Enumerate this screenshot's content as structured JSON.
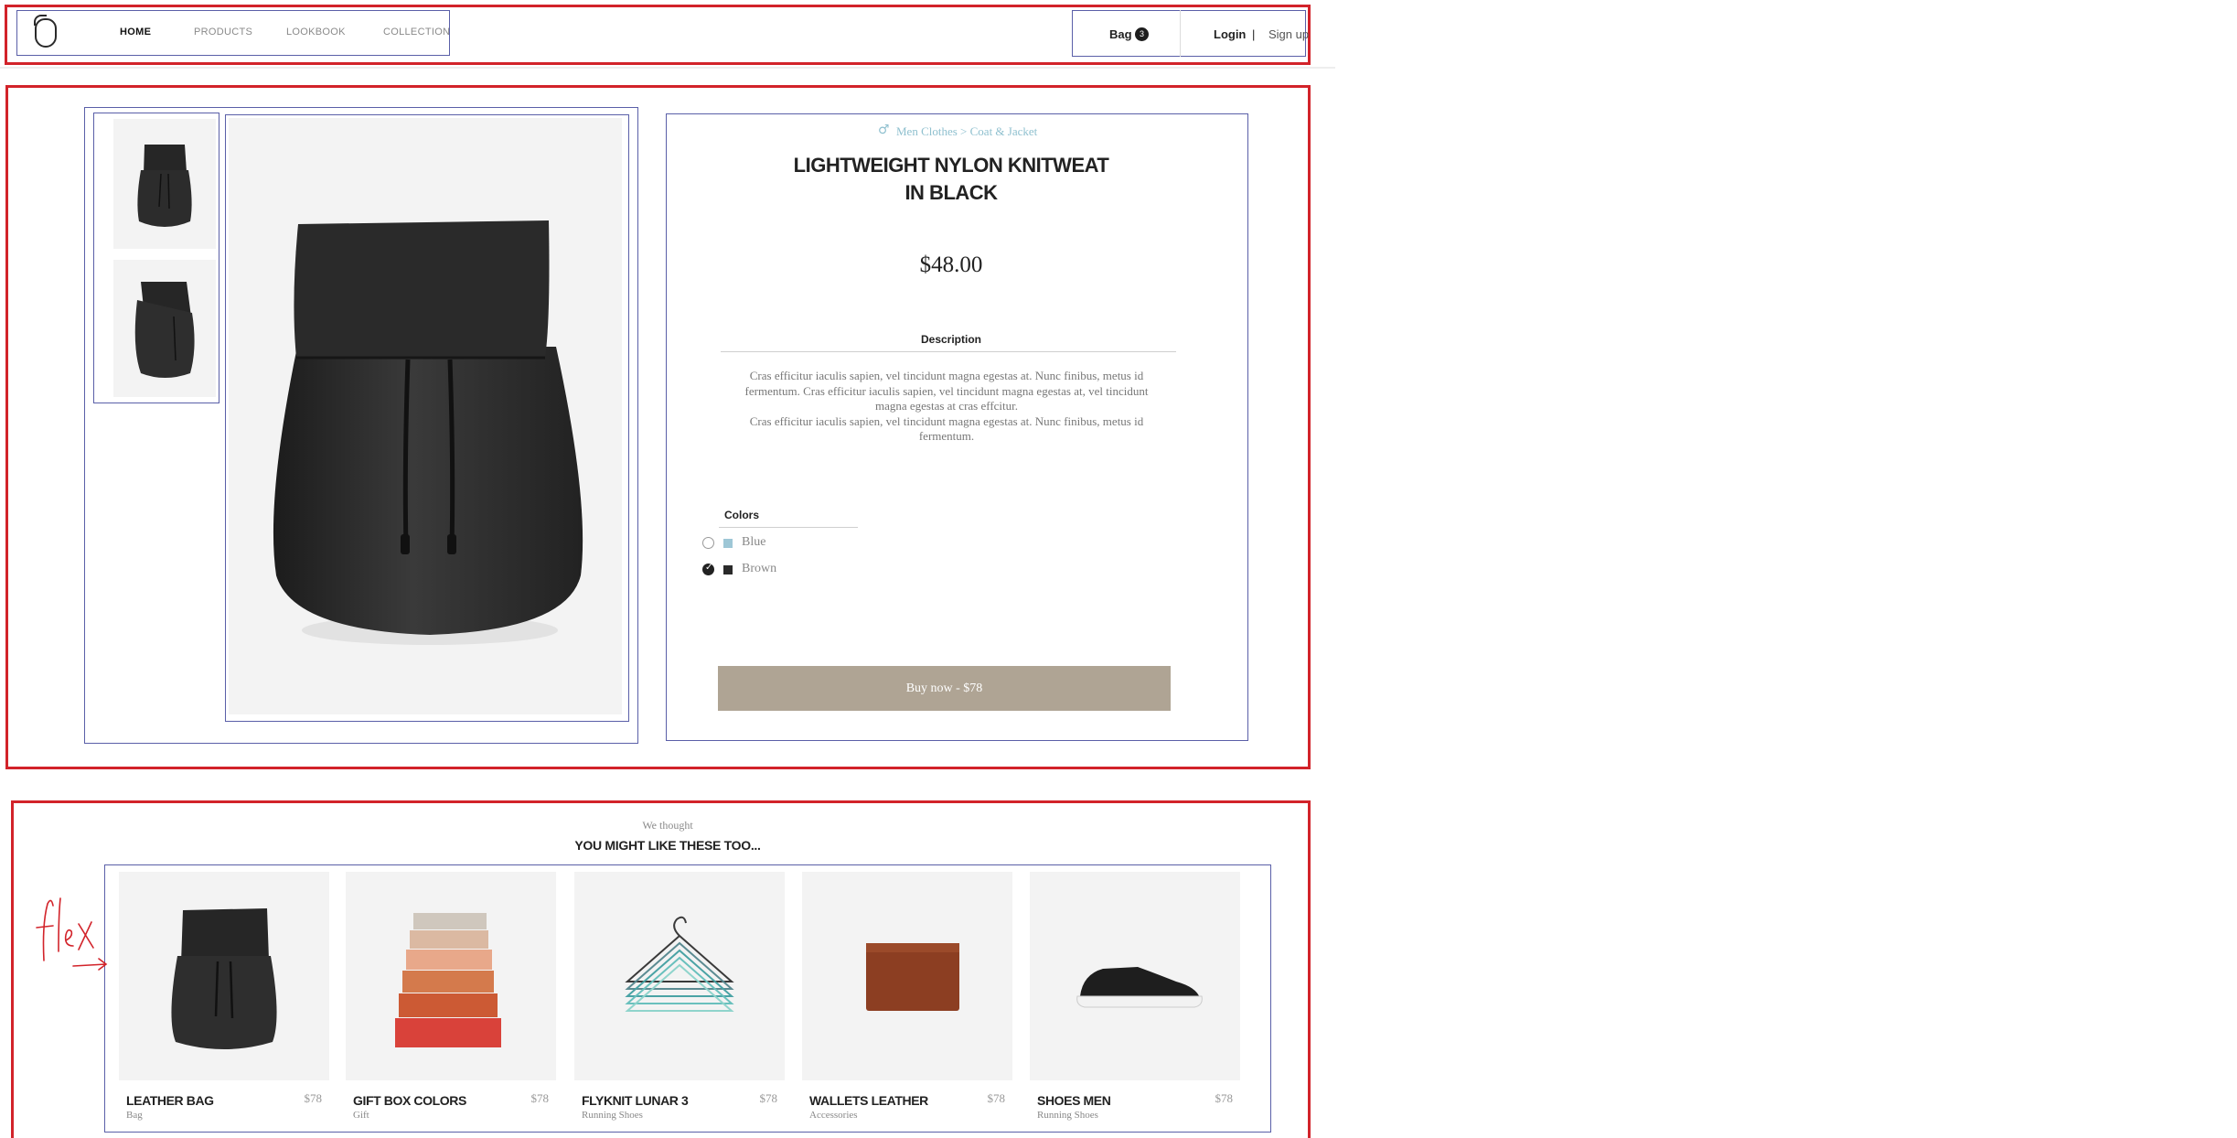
{
  "header": {
    "logo_alt": "B",
    "nav": [
      "HOME",
      "PRODUCTS",
      "LOOKBOOK",
      "COLLECTION"
    ],
    "bag_label": "Bag",
    "bag_count": "3",
    "login_label": "Login",
    "separator": "|",
    "signup_label": "Sign up"
  },
  "product": {
    "breadcrumb": "Men Clothes > Coat & Jacket",
    "title_line1": "LIGHTWEIGHT NYLON KNITWEAT",
    "title_line2": "IN BLACK",
    "price": "$48.00",
    "description_heading": "Description",
    "description_p1": "Cras efficitur iaculis sapien, vel tincidunt magna egestas at. Nunc finibus, metus id fermentum. Cras efficitur iaculis sapien, vel tincidunt magna egestas at, vel tincidunt magna egestas at cras effcitur.",
    "description_p2": "Cras efficitur iaculis sapien, vel tincidunt magna egestas at. Nunc finibus, metus id fermentum.",
    "colors_heading": "Colors",
    "colors": [
      {
        "label": "Blue",
        "swatch": "#9ec7d6",
        "selected": false
      },
      {
        "label": "Brown",
        "swatch": "#2a2a2a",
        "selected": true
      }
    ],
    "buy_label": "Buy now - $78"
  },
  "suggestions": {
    "subtitle": "We thought",
    "title": "YOU MIGHT LIKE THESE TOO...",
    "items": [
      {
        "name": "LEATHER BAG",
        "category": "Bag",
        "price": "$78"
      },
      {
        "name": "GIFT BOX COLORS",
        "category": "Gift",
        "price": "$78"
      },
      {
        "name": "FLYKNIT LUNAR 3",
        "category": "Running Shoes",
        "price": "$78"
      },
      {
        "name": "WALLETS LEATHER",
        "category": "Accessories",
        "price": "$78"
      },
      {
        "name": "SHOES MEN",
        "category": "Running Shoes",
        "price": "$78"
      }
    ]
  },
  "annotation": {
    "handwritten": "flex"
  },
  "colors": {
    "annotation_red": "#d2232a",
    "annotation_blue": "#5a5fa8",
    "button": "#afa494",
    "breadcrumb": "#8fc0cf"
  }
}
